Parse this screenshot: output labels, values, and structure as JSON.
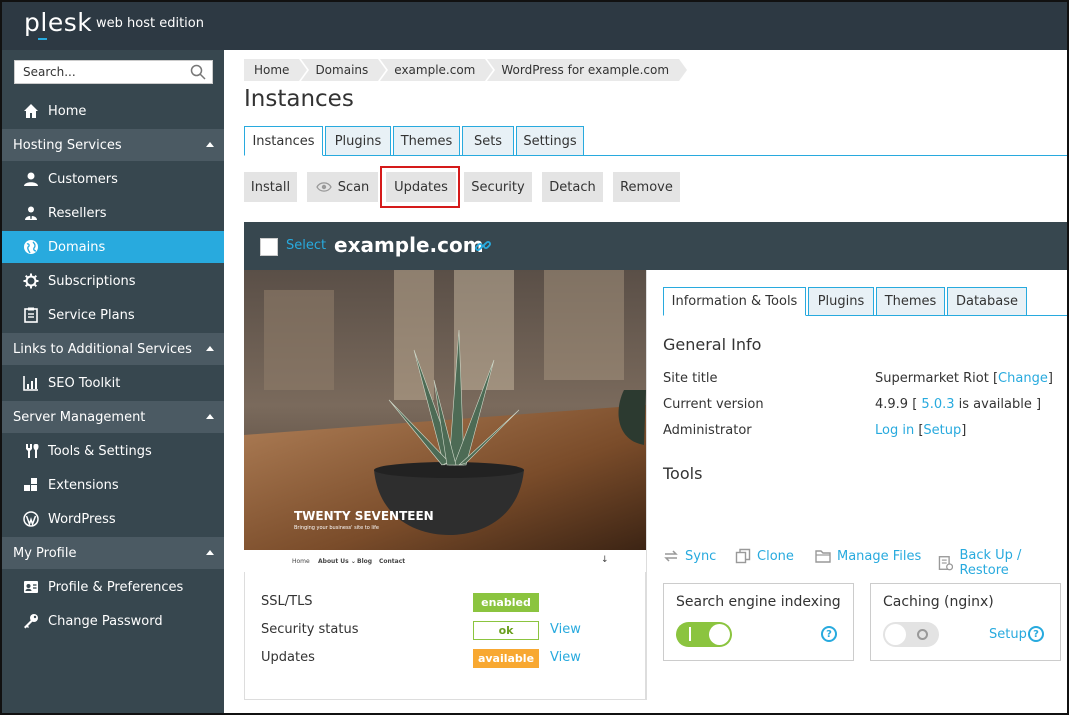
{
  "header": {
    "logo": "plesk",
    "edition": "web host edition"
  },
  "sidebar": {
    "search_placeholder": "Search...",
    "home": "Home",
    "groups": [
      {
        "label": "Hosting Services",
        "items": [
          "Customers",
          "Resellers",
          "Domains",
          "Subscriptions",
          "Service Plans"
        ]
      },
      {
        "label": "Links to Additional Services",
        "items": [
          "SEO Toolkit"
        ]
      },
      {
        "label": "Server Management",
        "items": [
          "Tools & Settings",
          "Extensions",
          "WordPress"
        ]
      },
      {
        "label": "My Profile",
        "items": [
          "Profile & Preferences",
          "Change Password"
        ]
      }
    ],
    "active_item": "Domains",
    "active_color": "#28aade"
  },
  "breadcrumb": [
    "Home",
    "Domains",
    "example.com",
    "WordPress for example.com"
  ],
  "page_title": "Instances",
  "tabs": [
    "Instances",
    "Plugins",
    "Themes",
    "Sets",
    "Settings"
  ],
  "active_tab": "Instances",
  "toolbar": [
    "Install",
    "Scan",
    "Updates",
    "Security",
    "Detach",
    "Remove"
  ],
  "highlighted_button": "Updates",
  "instance": {
    "select_label": "Select",
    "domain": "example.com",
    "preview": {
      "theme_title": "TWENTY SEVENTEEN",
      "tagline": "Bringing your business' site to life",
      "nav": [
        "Home",
        "About Us ⌄",
        "Blog",
        "Contact"
      ]
    },
    "status": [
      {
        "label": "SSL/TLS",
        "badge": "enabled",
        "link": ""
      },
      {
        "label": "Security status",
        "badge": "ok",
        "link": "View"
      },
      {
        "label": "Updates",
        "badge": "available",
        "link": "View"
      }
    ],
    "sub_tabs": [
      "Information & Tools",
      "Plugins",
      "Themes",
      "Database"
    ],
    "active_sub_tab": "Information & Tools",
    "general_info_title": "General Info",
    "site_title_label": "Site title",
    "site_title_value": "Supermarket Riot",
    "change_link": "Change",
    "current_version_label": "Current version",
    "current_version": "4.9.9",
    "available_version": "5.0.3",
    "available_text": "is available",
    "administrator_label": "Administrator",
    "login_link": "Log in",
    "setup_link": "Setup",
    "tools_title": "Tools",
    "tools": [
      "Sync",
      "Clone",
      "Manage Files",
      "Back Up / Restore"
    ],
    "cards": [
      {
        "title": "Search engine indexing",
        "on": true,
        "setup": ""
      },
      {
        "title": "Caching (nginx)",
        "on": false,
        "setup": "Setup"
      }
    ]
  }
}
